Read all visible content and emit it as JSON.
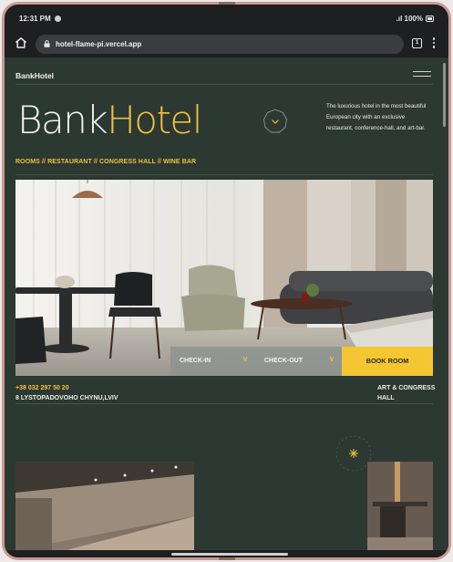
{
  "status": {
    "time": "12:31 PM",
    "battery": "100%"
  },
  "browser": {
    "url": "hotel-flame-pi.vercel.app",
    "tab_count": "1"
  },
  "header": {
    "brand": "BankHotel"
  },
  "hero_text": {
    "logo_part1": "Bank",
    "logo_part2": "Hotel",
    "intro": "The luxurious hotel in the most beautiful European city with an exclusive restaurant, conference-hall, and art-bar.",
    "subnav": "ROOMS // RESTAURANT // CONGRESS HALL // WINE BAR"
  },
  "booking": {
    "check_in": "CHECK-IN",
    "check_out": "CHECK-OUT",
    "book": "BOOK ROOM"
  },
  "contacts": {
    "phone": "+38 032 297 50 20",
    "address": "8 LYSTOPADOVOHO CHYNU,LVIV",
    "hall_line1": "ART & CONGRESS",
    "hall_line2": "HALL"
  },
  "colors": {
    "page_bg": "#2c3832",
    "accent": "#f0c040",
    "button": "#f4c631"
  }
}
